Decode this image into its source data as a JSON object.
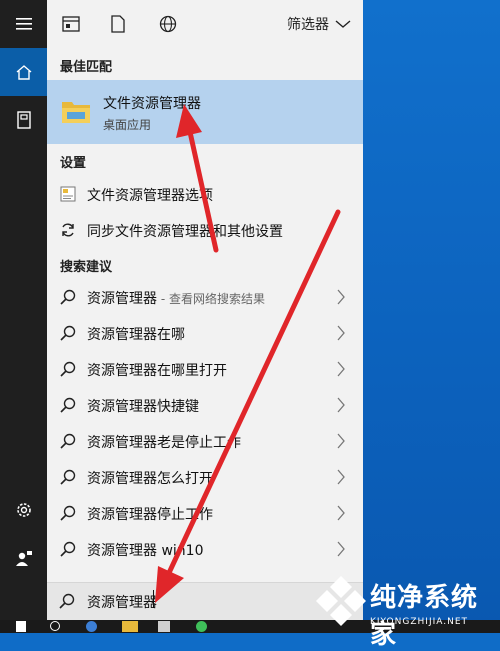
{
  "panel": {
    "filter_label": "筛选器",
    "best_match_header": "最佳匹配",
    "best_match": {
      "title": "文件资源管理器",
      "subtitle": "桌面应用"
    },
    "settings_header": "设置",
    "settings": [
      {
        "label": "文件资源管理器选项",
        "icon": "settings-page-icon"
      },
      {
        "label": "同步文件资源管理器和其他设置",
        "icon": "sync-icon"
      }
    ],
    "suggestions_header": "搜索建议",
    "suggestions": [
      {
        "label": "资源管理器",
        "suffix": " - 查看网络搜索结果"
      },
      {
        "label": "资源管理器在哪",
        "suffix": ""
      },
      {
        "label": "资源管理器在哪里打开",
        "suffix": ""
      },
      {
        "label": "资源管理器快捷键",
        "suffix": ""
      },
      {
        "label": "资源管理器老是停止工作",
        "suffix": ""
      },
      {
        "label": "资源管理器怎么打开",
        "suffix": ""
      },
      {
        "label": "资源管理器停止工作",
        "suffix": ""
      },
      {
        "label": "资源管理器 win10",
        "suffix": ""
      }
    ],
    "search_value": "资源管理器"
  },
  "watermark": {
    "text": "纯净系统家",
    "url": "KIYONGZHIJIA.NET"
  },
  "colors": {
    "accent": "#0b5ea8",
    "selected": "#b5d2ee",
    "arrow": "#e0262a",
    "desktop": "#0f6cc7"
  }
}
